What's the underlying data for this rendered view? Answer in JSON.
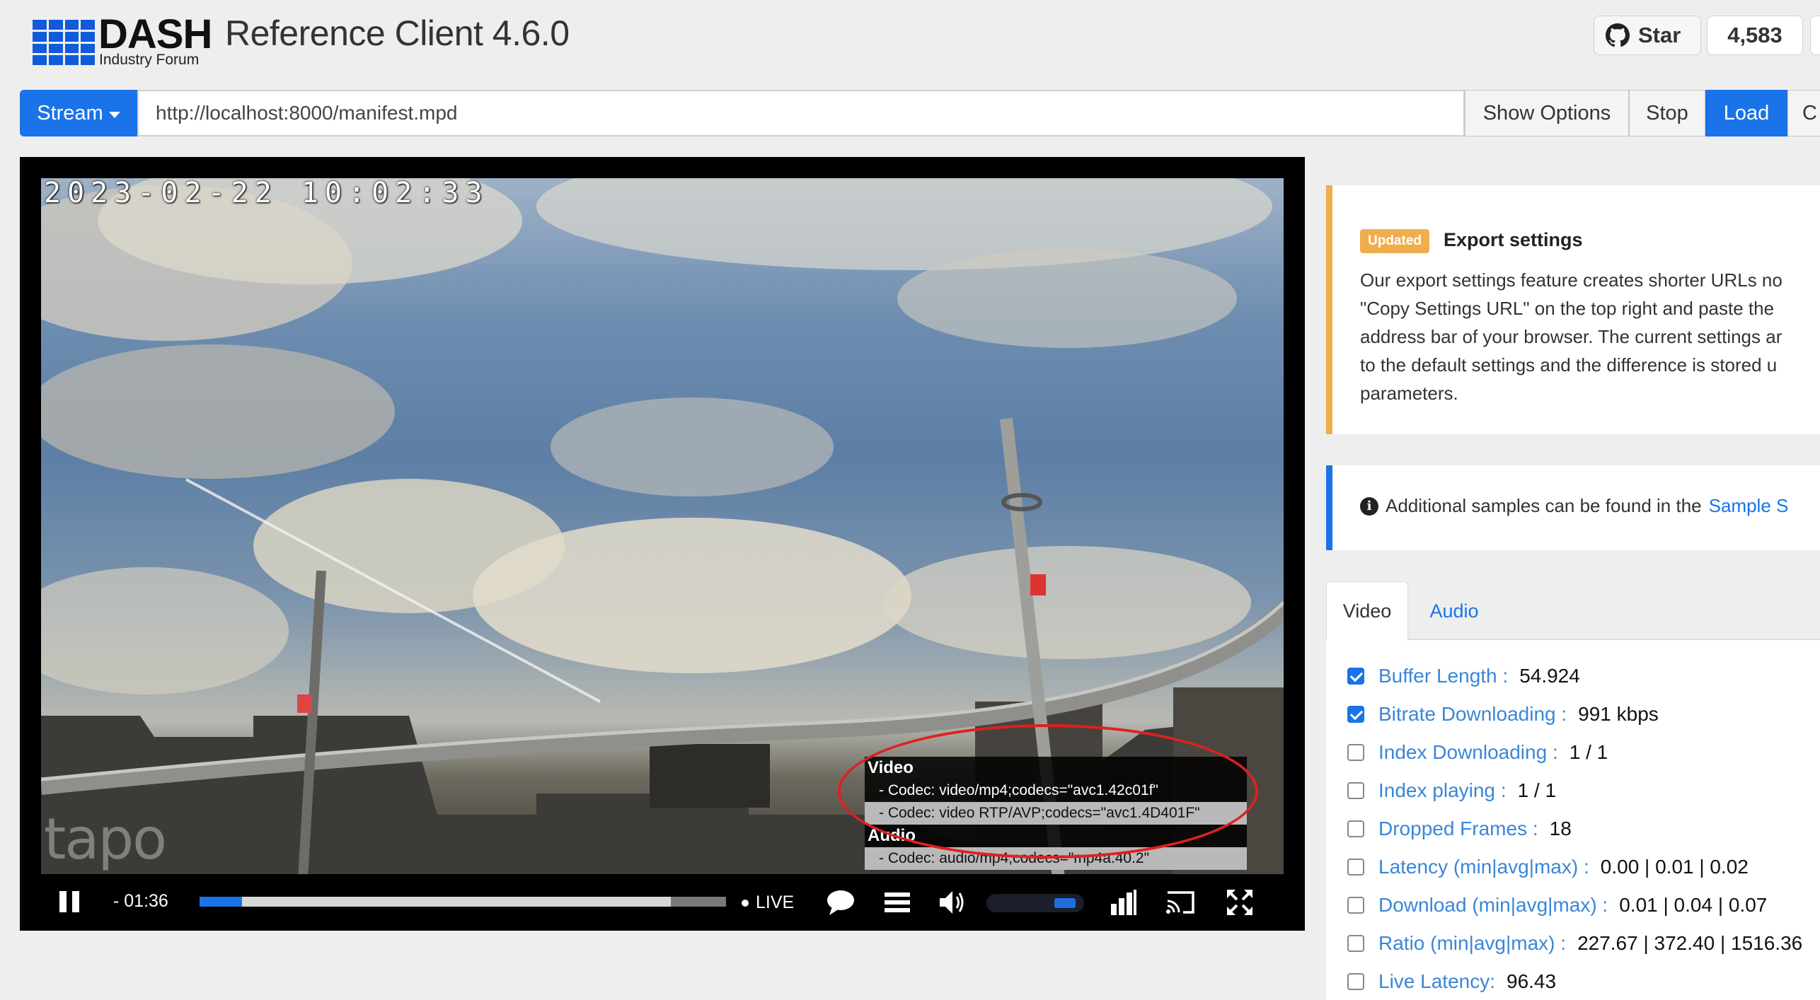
{
  "header": {
    "logo_text": "DASH",
    "logo_sub": "Industry Forum",
    "title": "Reference Client 4.6.0",
    "github_star_label": "Star",
    "github_star_count": "4,583"
  },
  "toolbar": {
    "stream_label": "Stream",
    "url_value": "http://localhost:8000/manifest.mpd",
    "show_options_label": "Show Options",
    "stop_label": "Stop",
    "load_label": "Load",
    "cut_label": "C"
  },
  "player": {
    "timestamp": "2023-02-22 10:02:33",
    "watermark": "tapo",
    "time_display": "- 01:36",
    "live_label": "LIVE",
    "seek_progress": 0.08,
    "volume_level": 1.0,
    "codec_info": {
      "video_heading": "Video",
      "video_codecs": [
        "- Codec: video/mp4;codecs=\"avc1.42c01f\"",
        "- Codec: video RTP/AVP;codecs=\"avc1.4D401F\""
      ],
      "audio_heading": "Audio",
      "audio_codecs": [
        "- Codec: audio/mp4;codecs=\"mp4a.40.2\""
      ]
    }
  },
  "notice": {
    "badge": "Updated",
    "title": "Export settings",
    "lines": [
      "Our export settings feature creates shorter URLs no",
      "\"Copy Settings URL\" on the top right and paste the",
      "address bar of your browser. The current settings ar",
      "to the default settings and the difference is stored u",
      "parameters."
    ]
  },
  "info": {
    "text": "Additional samples can be found in the",
    "link": "Sample S"
  },
  "tabs": {
    "video": "Video",
    "audio": "Audio"
  },
  "metrics": [
    {
      "label": "Buffer Length :",
      "value": "54.924",
      "checked": true
    },
    {
      "label": "Bitrate Downloading :",
      "value": "991 kbps",
      "checked": true
    },
    {
      "label": "Index Downloading :",
      "value": "1 / 1",
      "checked": false
    },
    {
      "label": "Index playing :",
      "value": "1 / 1",
      "checked": false
    },
    {
      "label": "Dropped Frames :",
      "value": "18",
      "checked": false
    },
    {
      "label": "Latency (min|avg|max) :",
      "value": "0.00 | 0.01 | 0.02",
      "checked": false
    },
    {
      "label": "Download (min|avg|max) :",
      "value": "0.01 | 0.04 | 0.07",
      "checked": false
    },
    {
      "label": "Ratio (min|avg|max) :",
      "value": "227.67 | 372.40 | 1516.36",
      "checked": false
    },
    {
      "label": "Live Latency:",
      "value": "96.43",
      "checked": false
    }
  ],
  "colors": {
    "primary": "#1a73e8",
    "warning": "#f0ad4e",
    "annotation": "#e02020"
  },
  "icons": [
    "github-icon",
    "pause-icon",
    "chat-icon",
    "menu-icon",
    "volume-icon",
    "bitrate-icon",
    "cast-icon",
    "fullscreen-icon",
    "info-icon"
  ]
}
